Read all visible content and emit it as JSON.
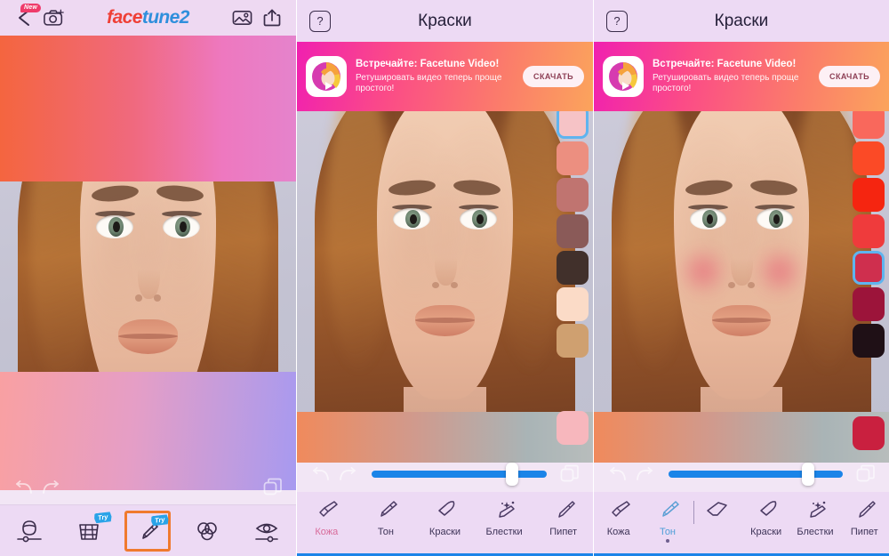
{
  "app": {
    "logo_first": "face",
    "logo_second": "tune2",
    "new_badge": "New"
  },
  "panel1": {
    "header": {
      "back_icon": "back-chevron-icon",
      "camera_icon": "camera-add-icon",
      "gallery_icon": "gallery-icon",
      "share_icon": "share-icon"
    },
    "controls": {
      "undo_icon": "undo-icon",
      "redo_icon": "redo-icon",
      "compare_icon": "compare-layers-icon"
    },
    "tools": [
      {
        "name": "face-reshape-tool",
        "icon": "face-slider-icon",
        "badge": "",
        "selected": false
      },
      {
        "name": "grid-patch-tool",
        "icon": "grid-icon",
        "badge": "Try",
        "selected": false
      },
      {
        "name": "makeup-brush-tool",
        "icon": "paint-brush-icon",
        "badge": "Try",
        "selected": true
      },
      {
        "name": "blur-tool",
        "icon": "clouds-icon",
        "badge": "",
        "selected": false
      },
      {
        "name": "eye-tool",
        "icon": "eye-slider-icon",
        "badge": "",
        "selected": false
      }
    ]
  },
  "panel2": {
    "header": {
      "help_label": "?",
      "title": "Краски"
    },
    "banner": {
      "title": "Встречайте: Facetune Video!",
      "subtitle": "Ретушировать видео теперь проще простого!",
      "button": "СКАЧАТЬ",
      "icon": "facetune-video-app-icon"
    },
    "swatches": [
      {
        "color": "#f6c3c6",
        "selected": true
      },
      {
        "color": "#ec8f80",
        "selected": false
      },
      {
        "color": "#c07470",
        "selected": false
      },
      {
        "color": "#8a5a58",
        "selected": false
      },
      {
        "color": "#41302b",
        "selected": false
      },
      {
        "color": "#fbdbc7",
        "selected": false
      },
      {
        "color": "#cfa070",
        "selected": false
      }
    ],
    "swatch_bottom": {
      "color": "#f7b7bd"
    },
    "slider": {
      "value_pct": 80,
      "fill_color": "#1b84e8"
    },
    "controls": {
      "undo_icon": "undo-icon",
      "redo_icon": "redo-icon",
      "compare_icon": "compare-layers-icon"
    },
    "tools": [
      {
        "label": "Кожа",
        "icon": "skin-brush-icon",
        "state": "active-pink"
      },
      {
        "label": "Тон",
        "icon": "tone-brush-icon",
        "state": "normal"
      },
      {
        "label": "Краски",
        "icon": "paint-marker-icon",
        "state": "normal"
      },
      {
        "label": "Блестки",
        "icon": "glitter-brush-icon",
        "state": "normal"
      },
      {
        "label": "Пипет",
        "icon": "eyedropper-icon",
        "state": "normal"
      }
    ]
  },
  "panel3": {
    "header": {
      "help_label": "?",
      "title": "Краски"
    },
    "banner": {
      "title": "Встречайте: Facetune Video!",
      "subtitle": "Ретушировать видео теперь проще простого!",
      "button": "СКАЧАТЬ",
      "icon": "facetune-video-app-icon"
    },
    "swatches": [
      {
        "color": "#f9685c",
        "selected": false
      },
      {
        "color": "#fb4a26",
        "selected": false
      },
      {
        "color": "#f52510",
        "selected": false
      },
      {
        "color": "#ef3b3c",
        "selected": false
      },
      {
        "color": "#cf2f4e",
        "selected": true
      },
      {
        "color": "#9c143a",
        "selected": false
      },
      {
        "color": "#1f1016",
        "selected": false
      }
    ],
    "swatch_bottom": {
      "color": "#c9203f"
    },
    "slider": {
      "value_pct": 80,
      "fill_color": "#1b84e8"
    },
    "controls": {
      "undo_icon": "undo-icon",
      "redo_icon": "redo-icon",
      "compare_icon": "compare-layers-icon"
    },
    "tools": [
      {
        "label": "Кожа",
        "icon": "skin-brush-icon",
        "state": "normal"
      },
      {
        "label": "Тон",
        "icon": "tone-brush-icon",
        "state": "active-blue"
      },
      {
        "label": "",
        "icon": "eraser-icon",
        "state": "normal"
      },
      {
        "label": "Краски",
        "icon": "paint-marker-icon",
        "state": "normal"
      },
      {
        "label": "Блестки",
        "icon": "glitter-brush-icon",
        "state": "normal"
      },
      {
        "label": "Пипет",
        "icon": "eyedropper-icon",
        "state": "normal"
      }
    ]
  }
}
